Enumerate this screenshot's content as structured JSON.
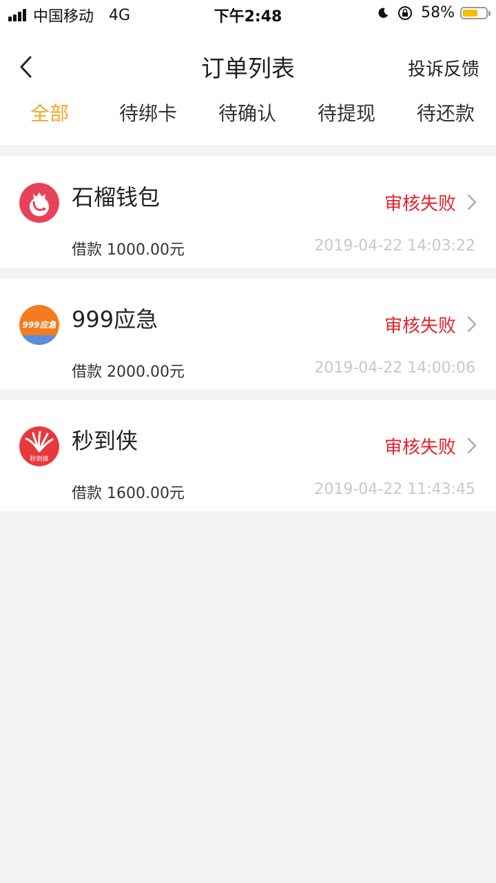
{
  "status_bar": {
    "carrier": "中国移动",
    "network": "4G",
    "time": "下午2:48",
    "battery": "58%",
    "battery_color": "#f6c000"
  },
  "header": {
    "title": "订单列表",
    "feedback": "投诉反馈",
    "back_icon": "chevron-left-icon"
  },
  "tabs": [
    {
      "label": "全部",
      "active": true
    },
    {
      "label": "待绑卡",
      "active": false
    },
    {
      "label": "待确认",
      "active": false
    },
    {
      "label": "待提现",
      "active": false
    },
    {
      "label": "待还款",
      "active": false
    }
  ],
  "accent_color": "#f5a623",
  "status_color": "#e8212b",
  "orders": [
    {
      "name": "石榴钱包",
      "status": "审核失败",
      "amount": "借款 1000.00元",
      "date": "2019-04-22 14:03:22"
    },
    {
      "name": "999应急",
      "status": "审核失败",
      "amount": "借款 2000.00元",
      "date": "2019-04-22 14:00:06",
      "logo_text": "999应急"
    },
    {
      "name": "秒到侠",
      "status": "审核失败",
      "amount": "借款 1600.00元",
      "date": "2019-04-22 11:43:45",
      "logo_text": "秒到侠"
    }
  ]
}
